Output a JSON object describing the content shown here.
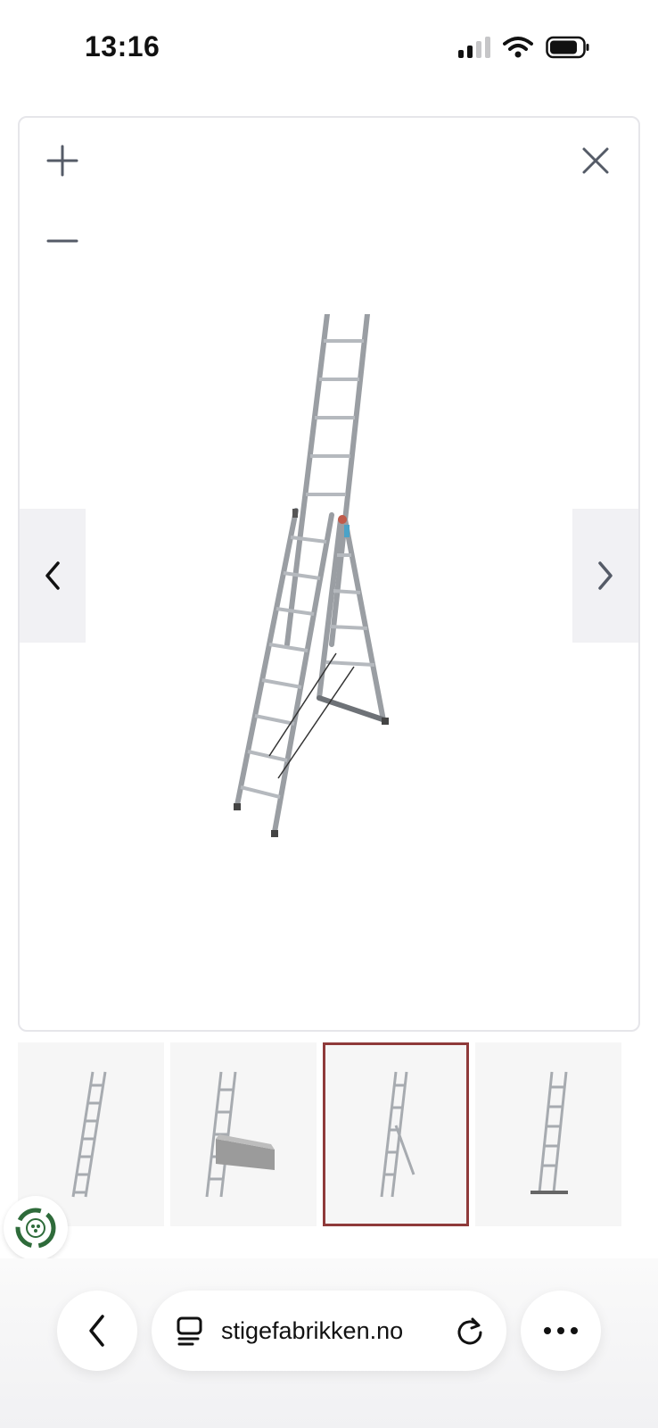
{
  "status_bar": {
    "time": "13:16",
    "icons": [
      "cellular-signal-icon",
      "wifi-icon",
      "battery-icon"
    ]
  },
  "viewer": {
    "controls": [
      "zoom-in-icon",
      "zoom-out-icon",
      "close-icon",
      "chevron-left-icon",
      "chevron-right-icon"
    ],
    "image": "three-section-aluminium-ladder"
  },
  "thumbnails": {
    "count": 4,
    "selected_index": 2,
    "accent_color": "#8f3a3a"
  },
  "browser": {
    "url": "stigefabrikken.no",
    "icons": [
      "back-icon",
      "tabs-icon",
      "reload-icon",
      "more-icon"
    ]
  },
  "eco_badge": {
    "icon": "eco-recycle-icon",
    "color": "#2e6b3a"
  }
}
